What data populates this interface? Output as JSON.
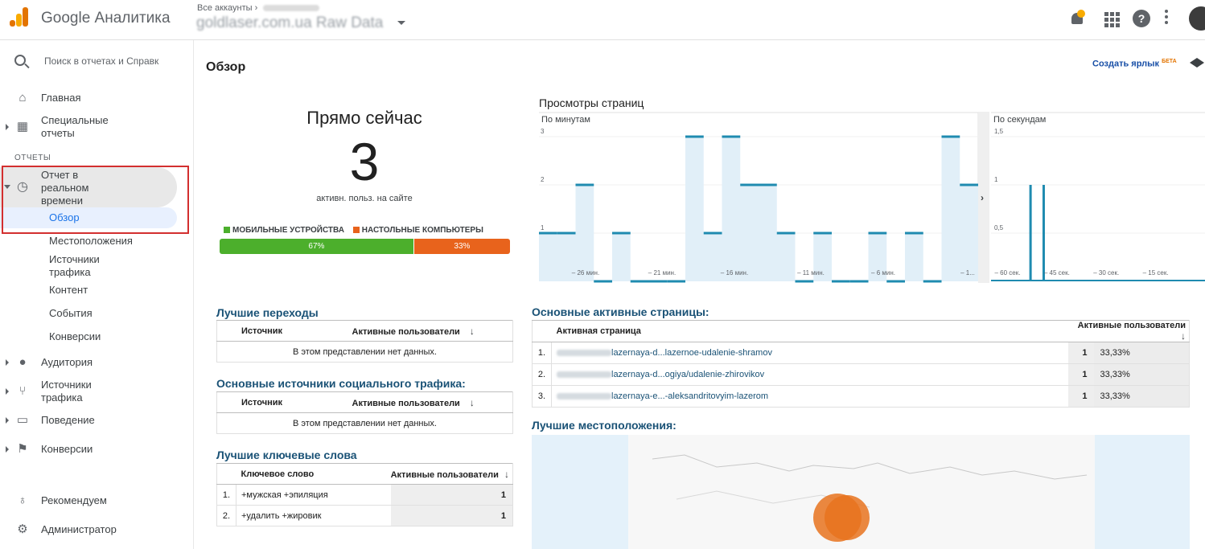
{
  "header": {
    "app_title": "Google Аналитика",
    "account_crumb": "Все аккаунты",
    "property_name": "goldlaser.com.ua Raw Data"
  },
  "sidebar": {
    "search_placeholder": "Поиск в отчетах и Справк",
    "home": "Главная",
    "custom_reports": "Специальные отчеты",
    "section_reports": "ОТЧЕТЫ",
    "realtime": "Отчет в реальном времени",
    "realtime_sub": [
      "Обзор",
      "Местоположения",
      "Источники трафика",
      "Контент",
      "События",
      "Конверсии"
    ],
    "audience": "Аудитория",
    "acquisition": "Источники трафика",
    "behavior": "Поведение",
    "conversions": "Конверсии",
    "recommend": "Рекомендуем",
    "admin": "Администратор"
  },
  "main": {
    "page_title": "Обзор",
    "shortcut": "Создать ярлык",
    "shortcut_badge": "БЕТА",
    "right_now": {
      "title": "Прямо сейчас",
      "count": "3",
      "subtitle": "активн. польз. на сайте",
      "mobile_label": "МОБИЛЬНЫЕ УСТРОЙСТВА",
      "desktop_label": "НАСТОЛЬНЫЕ КОМПЬЮТЕРЫ",
      "mobile_pct": "67%",
      "desktop_pct": "33%",
      "mobile_share": 67,
      "desktop_share": 33,
      "mobile_color": "#4caf2c",
      "desktop_color": "#e8631c"
    },
    "top_referrals": {
      "title": "Лучшие переходы",
      "col_source": "Источник",
      "col_users": "Активные пользователи",
      "empty": "В этом представлении нет данных."
    },
    "top_social": {
      "title": "Основные источники социального трафика:",
      "col_source": "Источник",
      "col_users": "Активные пользователи",
      "empty": "В этом представлении нет данных."
    },
    "top_keywords": {
      "title": "Лучшие ключевые слова",
      "col_keyword": "Ключевое слово",
      "col_users": "Активные пользователи",
      "rows": [
        {
          "n": "1.",
          "keyword": "+мужская +эпиляция",
          "users": "1"
        },
        {
          "n": "2.",
          "keyword": "+удалить +жировик",
          "users": "1"
        }
      ]
    },
    "top_pages": {
      "title": "Основные активные страницы:",
      "col_page": "Активная страница",
      "col_users": "Активные пользователи",
      "rows": [
        {
          "n": "1.",
          "page": "lazernaya-d...lazernoe-udalenie-shramov",
          "users": "1",
          "pct": "33,33%"
        },
        {
          "n": "2.",
          "page": "lazernaya-d...ogiya/udalenie-zhirovikov",
          "users": "1",
          "pct": "33,33%"
        },
        {
          "n": "3.",
          "page": "lazernaya-e...-aleksandritovyim-lazerom",
          "users": "1",
          "pct": "33,33%"
        }
      ]
    },
    "top_locations": {
      "title": "Лучшие местоположения:"
    }
  },
  "chart_data": [
    {
      "type": "area",
      "title": "Просмотры страниц",
      "subtitle": "По минутам",
      "y_ticks": [
        "1",
        "2",
        "3"
      ],
      "ylim": [
        0,
        3.5
      ],
      "x_tick_labels": [
        "– 26 мин.",
        "– 21 мин.",
        "– 16 мин.",
        "– 11 мин.",
        "– 6 мин.",
        "– 1..."
      ],
      "values": [
        1,
        1,
        2,
        0,
        1,
        0,
        0,
        0,
        3,
        1,
        3,
        2,
        2,
        1,
        0,
        1,
        0,
        0,
        1,
        0,
        1,
        0,
        3,
        2
      ],
      "color": "#1f8bb0"
    },
    {
      "type": "bar",
      "subtitle": "По секундам",
      "y_ticks": [
        "0,5",
        "1",
        "1,5"
      ],
      "ylim": [
        0,
        1.75
      ],
      "x_tick_labels": [
        "– 60 сек.",
        "– 45 сек.",
        "– 30 сек.",
        "– 15 сек."
      ],
      "bars": [
        {
          "sec": -53,
          "value": 1
        },
        {
          "sec": -49,
          "value": 1
        }
      ],
      "color": "#1f8bb0"
    }
  ]
}
